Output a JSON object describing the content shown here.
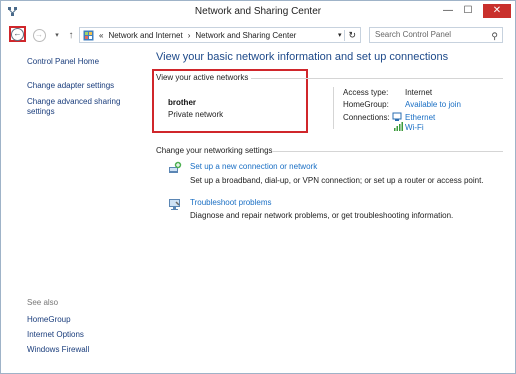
{
  "window": {
    "title": "Network and Sharing Center",
    "minimize": "—",
    "maximize": "☐",
    "close": "✕"
  },
  "nav": {
    "breadcrumb_prefix": "«",
    "breadcrumb": [
      "Network and Internet",
      "Network and Sharing Center"
    ],
    "search_placeholder": "Search Control Panel"
  },
  "left_pane": {
    "home": "Control Panel Home",
    "links": [
      "Change adapter settings",
      "Change advanced sharing settings"
    ],
    "see_also_label": "See also",
    "see_also": [
      "HomeGroup",
      "Internet Options",
      "Windows Firewall"
    ]
  },
  "main": {
    "title": "View your basic network information and set up connections",
    "active_networks_label": "View your active networks",
    "network": {
      "name": "brother",
      "category": "Private network",
      "access_type_label": "Access type:",
      "access_type": "Internet",
      "homegroup_label": "HomeGroup:",
      "homegroup": "Available to join",
      "connections_label": "Connections:",
      "connections": [
        "Ethernet",
        "Wi-Fi"
      ]
    },
    "settings_label": "Change your networking settings",
    "tasks": [
      {
        "title": "Set up a new connection or network",
        "desc": "Set up a broadband, dial-up, or VPN connection; or set up a router or access point."
      },
      {
        "title": "Troubleshoot problems",
        "desc": "Diagnose and repair network problems, or get troubleshooting information."
      }
    ]
  }
}
